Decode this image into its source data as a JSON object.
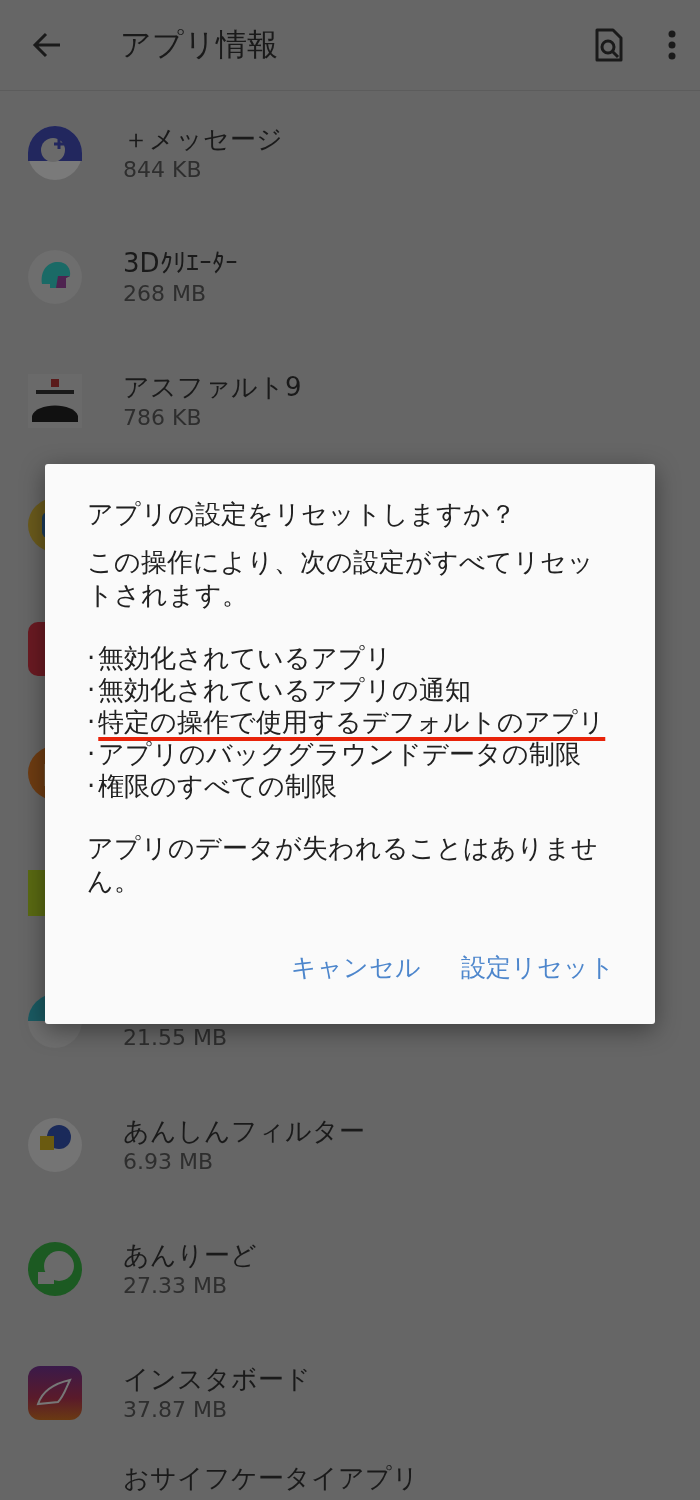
{
  "app_bar": {
    "title": "アプリ情報"
  },
  "apps": [
    {
      "name": "＋メッセージ",
      "size": "844 KB"
    },
    {
      "name": "3Dｸﾘｴｰﾀｰ",
      "size": "268 MB"
    },
    {
      "name": "アスファルト9",
      "size": "786 KB"
    },
    {
      "kind": "covered"
    },
    {
      "kind": "covered"
    },
    {
      "kind": "covered"
    },
    {
      "kind": "covered"
    },
    {
      "kind": "covered",
      "size": "21.55 MB"
    },
    {
      "name": "あんしんフィルター",
      "size": "6.93 MB"
    },
    {
      "name": "あんりーど",
      "size": "27.33 MB"
    },
    {
      "name": "インスタボード",
      "size": "37.87 MB"
    },
    {
      "kind": "cut",
      "name": "おサイフケータイアプリ"
    }
  ],
  "dialog": {
    "title": "アプリの設定をリセットしますか？",
    "intro": "この操作により、次の設定がすべてリセットされます。",
    "items": [
      {
        "marker": "·",
        "text": "無効化されているアプリ",
        "underlined": false
      },
      {
        "marker": "·",
        "text": "無効化されているアプリの通知",
        "underlined": false
      },
      {
        "marker": "·",
        "text": "特定の操作で使用するデフォルトのアプリ",
        "underlined": true
      },
      {
        "marker": "·",
        "text": "アプリのバックグラウンドデータの制限",
        "underlined": false
      },
      {
        "marker": "·",
        "text": "権限のすべての制限",
        "underlined": false
      }
    ],
    "note": "アプリのデータが失われることはありません。",
    "buttons": [
      "キャンセル",
      "設定リセット"
    ]
  }
}
